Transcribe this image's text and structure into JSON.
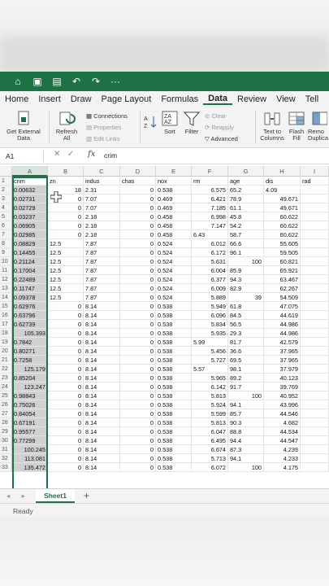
{
  "accent": "#1e7145",
  "quick_access": {
    "icons": [
      "home-icon",
      "save-icon",
      "save-as-icon",
      "undo-icon",
      "redo-icon",
      "more-icon"
    ],
    "more_label": "···"
  },
  "menu": {
    "tabs": [
      "Home",
      "Insert",
      "Draw",
      "Page Layout",
      "Formulas",
      "Data",
      "Review",
      "View",
      "Tell"
    ],
    "active": "Data"
  },
  "ribbon": {
    "get_external_data": "Get External Data",
    "refresh_all": "Refresh All",
    "connections": "Connections",
    "properties": "Properties",
    "edit_links": "Edit Links",
    "sort": "Sort",
    "filter": "Filter",
    "clear": "Clear",
    "reapply": "Reapply",
    "advanced": "Advanced",
    "text_to_columns": "Text to Columns",
    "flash_fill": "Flash Fill",
    "remove_duplicates": "Remo Duplica"
  },
  "formula_bar": {
    "name_box": "A1",
    "fx": "fx",
    "value": "crim"
  },
  "columns": [
    "A",
    "B",
    "C",
    "D",
    "E",
    "F",
    "G",
    "H",
    "I"
  ],
  "rows": [
    [
      "crim",
      "zn",
      "indus",
      "chas",
      "nox",
      "rm",
      "age",
      "dis",
      "rad"
    ],
    [
      "0.00632",
      "18",
      "2.31",
      "0",
      "0.538",
      "6.575",
      "65.2",
      "4.09",
      ""
    ],
    [
      "0.02731",
      "0",
      "7.07",
      "0",
      "0.469",
      "6.421",
      "78.9",
      "49.671",
      ""
    ],
    [
      "0.02729",
      "0",
      "7.07",
      "0",
      "0.469",
      "7.185",
      "61.1",
      "49.671",
      ""
    ],
    [
      "0.03237",
      "0",
      "2.18",
      "0",
      "0.458",
      "6.998",
      "45.8",
      "60.622",
      ""
    ],
    [
      "0.06905",
      "0",
      "2.18",
      "0",
      "0.458",
      "7.147",
      "54.2",
      "60.622",
      ""
    ],
    [
      "0.02985",
      "0",
      "2.18",
      "0",
      "0.458",
      "6.43",
      "58.7",
      "60.622",
      ""
    ],
    [
      "0.08829",
      "12.5",
      "7.87",
      "0",
      "0.524",
      "6.012",
      "66.6",
      "55.605",
      ""
    ],
    [
      "0.14455",
      "12.5",
      "7.87",
      "0",
      "0.524",
      "6.172",
      "96.1",
      "59.505",
      ""
    ],
    [
      "0.21124",
      "12.5",
      "7.87",
      "0",
      "0.524",
      "5.631",
      "100",
      "60.821",
      ""
    ],
    [
      "0.17004",
      "12.5",
      "7.87",
      "0",
      "0.524",
      "6.004",
      "85.9",
      "65.921",
      ""
    ],
    [
      "0.22489",
      "12.5",
      "7.87",
      "0",
      "0.524",
      "6.377",
      "94.3",
      "63.467",
      ""
    ],
    [
      "0.11747",
      "12.5",
      "7.87",
      "0",
      "0.524",
      "6.009",
      "82.9",
      "62.267",
      ""
    ],
    [
      "0.09378",
      "12.5",
      "7.87",
      "0",
      "0.524",
      "5.889",
      "39",
      "54.509",
      ""
    ],
    [
      "0.62976",
      "0",
      "8.14",
      "0",
      "0.538",
      "5.949",
      "61.8",
      "47.075",
      ""
    ],
    [
      "0.63796",
      "0",
      "8.14",
      "0",
      "0.538",
      "6.096",
      "84.5",
      "44.619",
      ""
    ],
    [
      "0.62739",
      "0",
      "8.14",
      "0",
      "0.538",
      "5.834",
      "56.5",
      "44.986",
      ""
    ],
    [
      "105.393",
      "0",
      "8.14",
      "0",
      "0.538",
      "5.935",
      "29.3",
      "44.986",
      ""
    ],
    [
      "0.7842",
      "0",
      "8.14",
      "0",
      "0.538",
      "5.99",
      "81.7",
      "42.579",
      ""
    ],
    [
      "0.80271",
      "0",
      "8.14",
      "0",
      "0.538",
      "5.456",
      "36.6",
      "37.965",
      ""
    ],
    [
      "0.7258",
      "0",
      "8.14",
      "0",
      "0.538",
      "5.727",
      "69.5",
      "37.965",
      ""
    ],
    [
      "125.179",
      "0",
      "8.14",
      "0",
      "0.538",
      "5.57",
      "98.1",
      "37.979",
      ""
    ],
    [
      "0.85204",
      "0",
      "8.14",
      "0",
      "0.538",
      "5.965",
      "89.2",
      "40.123",
      ""
    ],
    [
      "123.247",
      "0",
      "8.14",
      "0",
      "0.538",
      "6.142",
      "91.7",
      "39.769",
      ""
    ],
    [
      "0.98843",
      "0",
      "8.14",
      "0",
      "0.538",
      "5.813",
      "100",
      "40.952",
      ""
    ],
    [
      "0.75026",
      "0",
      "8.14",
      "0",
      "0.538",
      "5.924",
      "94.1",
      "43.996",
      ""
    ],
    [
      "0.84054",
      "0",
      "8.14",
      "0",
      "0.538",
      "5.599",
      "85.7",
      "44.546",
      ""
    ],
    [
      "0.67191",
      "0",
      "8.14",
      "0",
      "0.538",
      "5.813",
      "90.3",
      "4.682",
      ""
    ],
    [
      "0.95577",
      "0",
      "8.14",
      "0",
      "0.538",
      "6.047",
      "88.8",
      "44.534",
      ""
    ],
    [
      "0.77299",
      "0",
      "8.14",
      "0",
      "0.538",
      "6.495",
      "94.4",
      "44.547",
      ""
    ],
    [
      "100.245",
      "0",
      "8.14",
      "0",
      "0.538",
      "6.674",
      "87.3",
      "4.239",
      ""
    ],
    [
      "113.081",
      "0",
      "8.14",
      "0",
      "0.538",
      "5.713",
      "94.1",
      "4.233",
      ""
    ],
    [
      "135.472",
      "0",
      "8.14",
      "0",
      "0.538",
      "6.072",
      "100",
      "4.175",
      ""
    ]
  ],
  "sheet": {
    "name": "Sheet1",
    "add": "+",
    "nav": "◂ ▸"
  },
  "status": "Ready"
}
